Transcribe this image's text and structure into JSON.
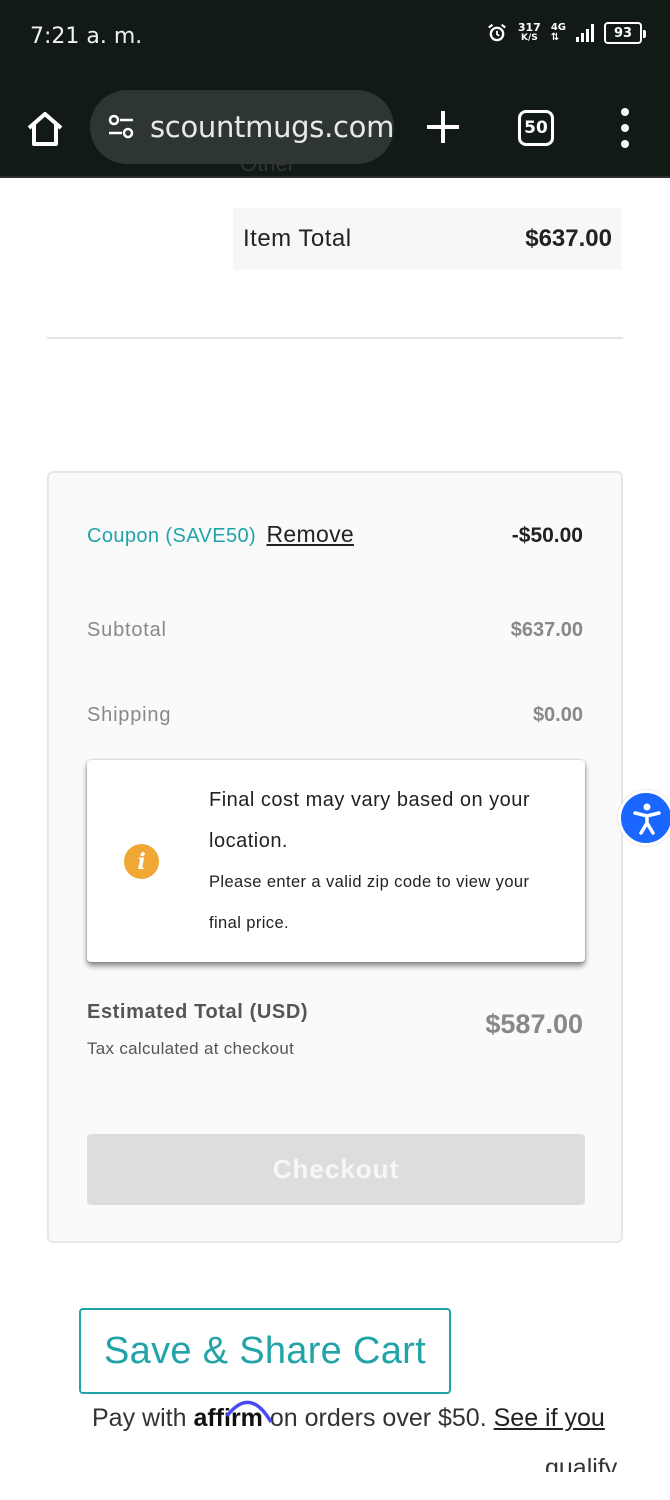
{
  "status_bar": {
    "time": "7:21 a. m.",
    "net_speed": "317",
    "net_speed_unit": "K/S",
    "network_type": "4G",
    "battery": "93"
  },
  "browser": {
    "url": "scountmugs.com",
    "tab_count": "50"
  },
  "cart": {
    "cut_off_text": "Other",
    "item_total_label": "Item Total",
    "item_total_value": "$637.00"
  },
  "summary": {
    "coupon_label": "Coupon (SAVE50)",
    "remove_label": "Remove",
    "coupon_amount": "-$50.00",
    "subtotal_label": "Subtotal",
    "subtotal_value": "$637.00",
    "shipping_label": "Shipping",
    "shipping_value": "$0.00",
    "notice_title": "Final cost may vary based on your location.",
    "notice_body": "Please enter a valid zip code to view your final price.",
    "estimated_total_label": "Estimated Total (USD)",
    "tax_note": "Tax calculated at checkout",
    "estimated_total_value": "$587.00",
    "checkout_label": "Checkout"
  },
  "save_share_label": "Save & Share Cart",
  "affirm": {
    "prefix": "Pay with ",
    "logo_text": "affirm",
    "middle": " on orders over $50. ",
    "link_text": "See if you",
    "link_text_cont": "qualify"
  },
  "colors": {
    "accent_teal": "#21a3a8",
    "info_orange": "#f0a733",
    "a11y_blue": "#1a66ff",
    "affirm_purple": "#4a4af4"
  }
}
